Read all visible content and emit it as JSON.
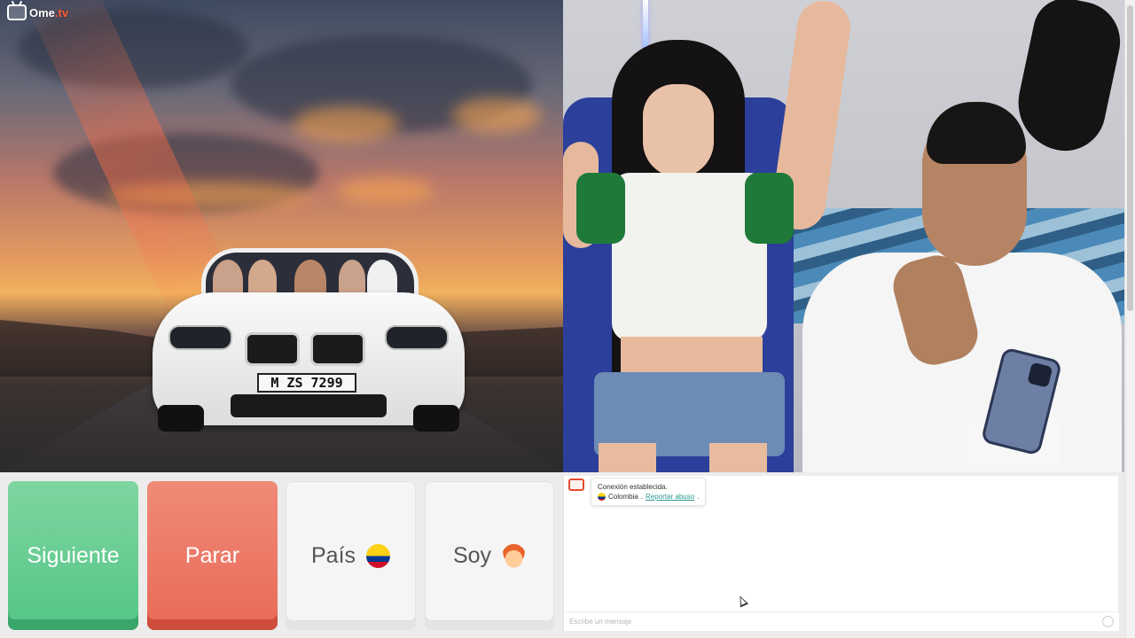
{
  "app": {
    "logo_text": "Ome",
    "logo_tld": ".tv",
    "accent_color": "#ff5a36"
  },
  "video": {
    "left_label": "local camera",
    "right_label": "remote camera",
    "plate_text": "M ZS 7299"
  },
  "controls": {
    "next_label": "Siguiente",
    "stop_label": "Parar",
    "country_label": "País",
    "me_label": "Soy",
    "next_color": "#62cc8f",
    "stop_color": "#ec7764",
    "country_icon": "colombia-flag-icon",
    "me_icon": "boy-emoji-icon"
  },
  "chat": {
    "system_message": "Conexión establecida.",
    "country_name": "Colombia",
    "report_link": "Reportar abuso",
    "input_placeholder": "Escribe un mensaje",
    "input_value": ""
  }
}
